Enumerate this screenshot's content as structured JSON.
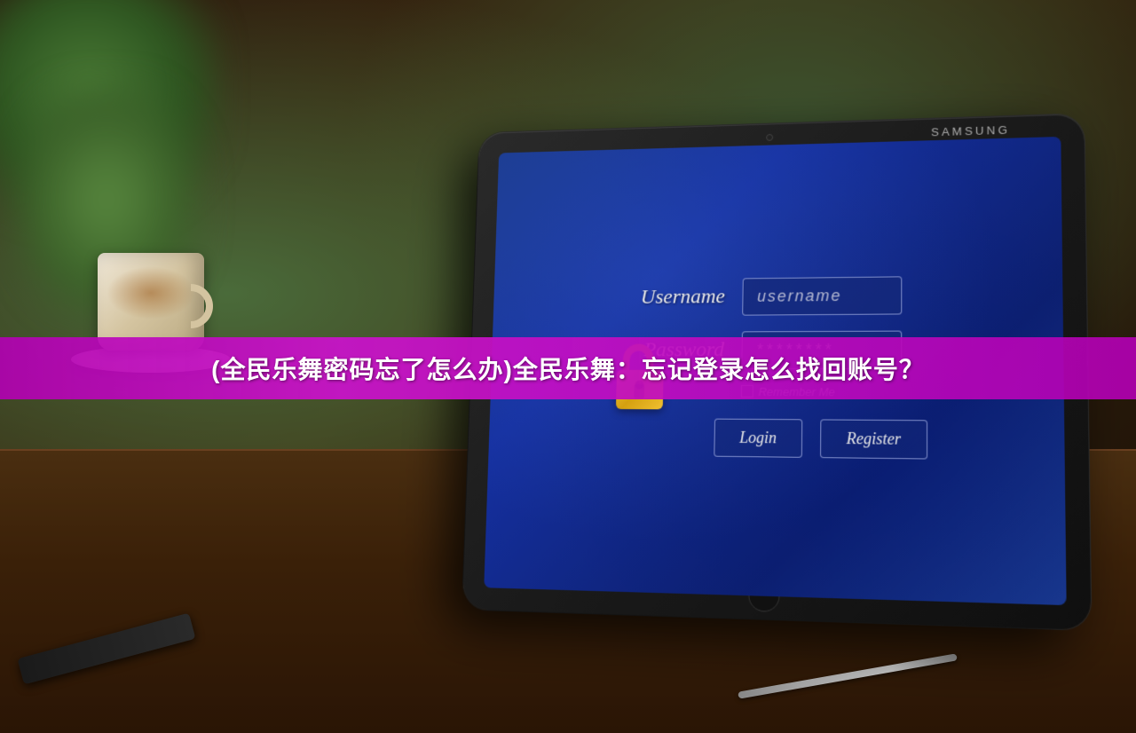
{
  "background": {
    "color_dark": "#2a1a0e",
    "table_color": "#3a2008"
  },
  "tablet": {
    "brand": "SAMSUNG",
    "screen_bg": "#1a3a8f"
  },
  "login_form": {
    "username_label": "Username",
    "username_placeholder": "username",
    "password_label": "Password",
    "password_value": "********",
    "remember_label": "Remember Me",
    "login_btn": "Login",
    "register_btn": "Register"
  },
  "banner": {
    "text": "(全民乐舞密码忘了怎么办)全民乐舞：忘记登录怎么找回账号？"
  }
}
